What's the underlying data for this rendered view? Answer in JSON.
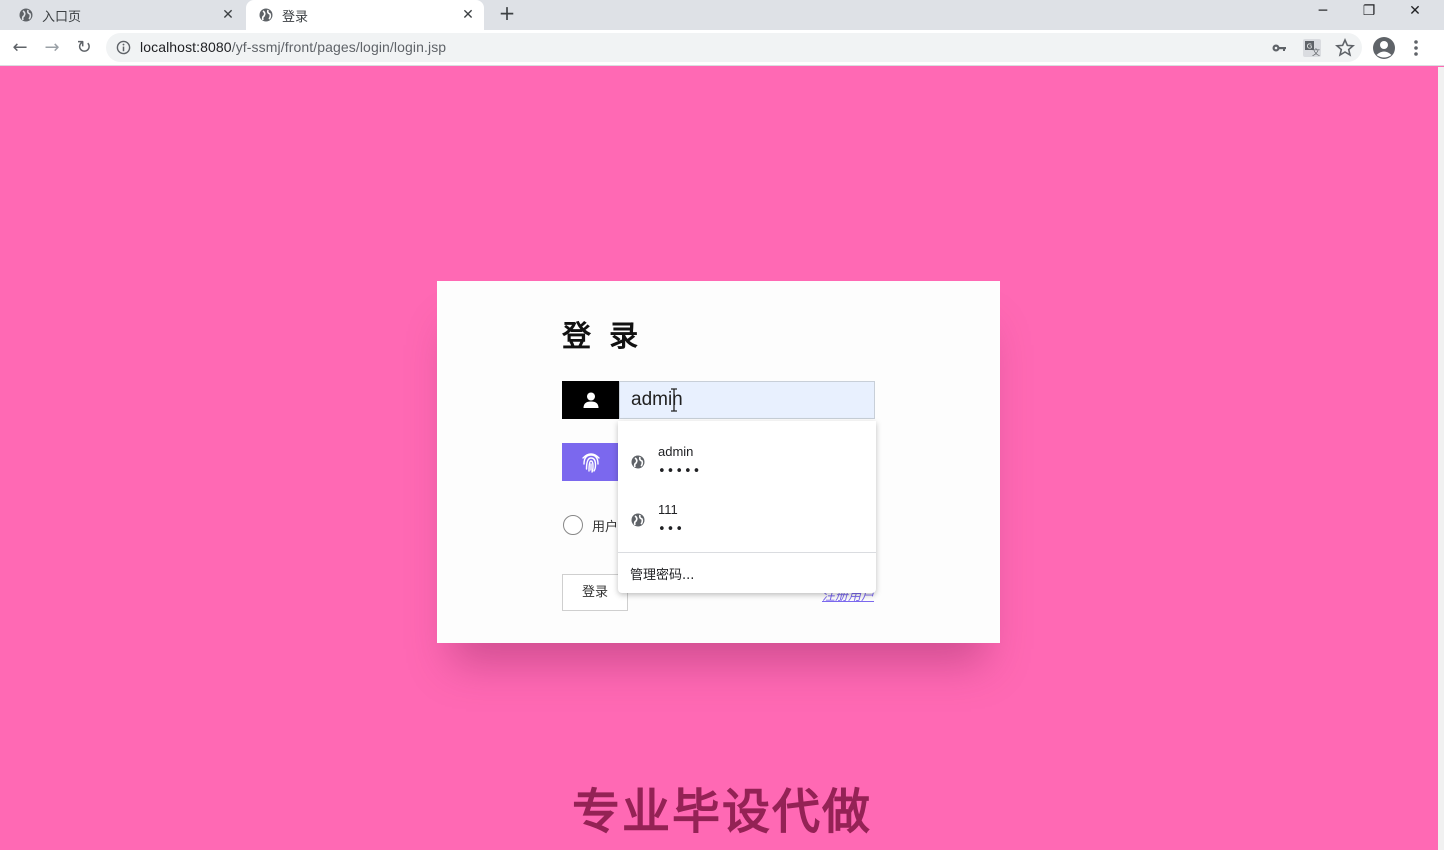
{
  "browser": {
    "tabs": [
      {
        "title": "入口页",
        "active": false
      },
      {
        "title": "登录",
        "active": true
      }
    ],
    "new_tab_glyph": "+",
    "window_controls": {
      "minimize": "─",
      "restore": "❐",
      "close": "✕"
    },
    "url_host": "localhost:8080",
    "url_path": "/yf-ssmj/front/pages/login/login.jsp",
    "nav": {
      "back": "←",
      "forward": "→",
      "reload": "↻"
    }
  },
  "login": {
    "title": "登 录",
    "username_value": "admin",
    "radio_label": "用户",
    "login_button": "登录",
    "register_link": "注册用户"
  },
  "autofill": {
    "entries": [
      {
        "username": "admin",
        "password_mask": "•••••"
      },
      {
        "username": "111",
        "password_mask": "•••"
      }
    ],
    "manage_label": "管理密码..."
  },
  "watermark": "专业毕设代做",
  "colors": {
    "page_background": "#ff69b4",
    "user_icon_bg": "#000000",
    "fingerprint_icon_bg": "#7b68ee",
    "input_autofill_bg": "#e8f0fe",
    "watermark": "#8b1c4d"
  },
  "icons": [
    "globe-icon",
    "close-icon",
    "back-icon",
    "forward-icon",
    "reload-icon",
    "info-icon",
    "key-icon",
    "translate-icon",
    "star-icon",
    "profile-icon",
    "menu-icon",
    "user-icon",
    "fingerprint-icon",
    "text-cursor-icon"
  ]
}
